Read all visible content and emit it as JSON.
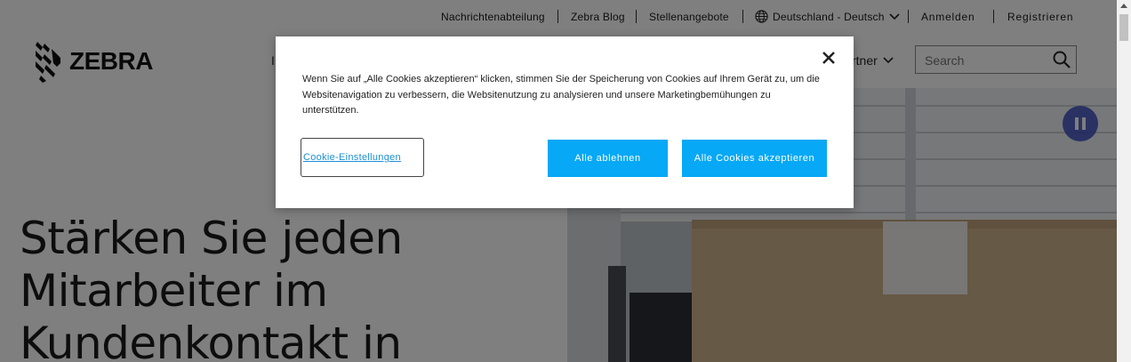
{
  "utility_nav": {
    "newsroom": "Nachrichtenabteilung",
    "blog": "Zebra Blog",
    "careers": "Stellenangebote",
    "region": "Deutschland - Deutsch",
    "login": "Anmelden",
    "register": "Registrieren"
  },
  "header": {
    "logo_text": "ZEBRA",
    "nav_partial_left": "I",
    "nav_partial_right": "rtner",
    "search_placeholder": "Search"
  },
  "hero": {
    "heading": "Stärken Sie jeden Mitarbeiter im Kundenkontakt in"
  },
  "cookie_banner": {
    "text": "Wenn Sie auf „Alle Cookies akzeptieren“ klicken, stimmen Sie der Speicherung von Cookies auf Ihrem Gerät zu, um die Websitenavigation zu verbessern, die Websitenutzung zu analysieren und unsere Marketingbemühungen zu unterstützen.",
    "settings_label": "Cookie-Einstellungen",
    "reject_label": "Alle ablehnen",
    "accept_label": "Alle Cookies akzeptieren"
  },
  "colors": {
    "accent_button": "#07a8f5",
    "pause_button": "#3a4cc1",
    "overlay": "rgba(0,0,0,0.5)"
  },
  "icons": {
    "globe": "globe-icon",
    "chevron": "chevron-down-icon",
    "search": "search-icon",
    "close": "close-icon",
    "pause": "pause-icon"
  }
}
